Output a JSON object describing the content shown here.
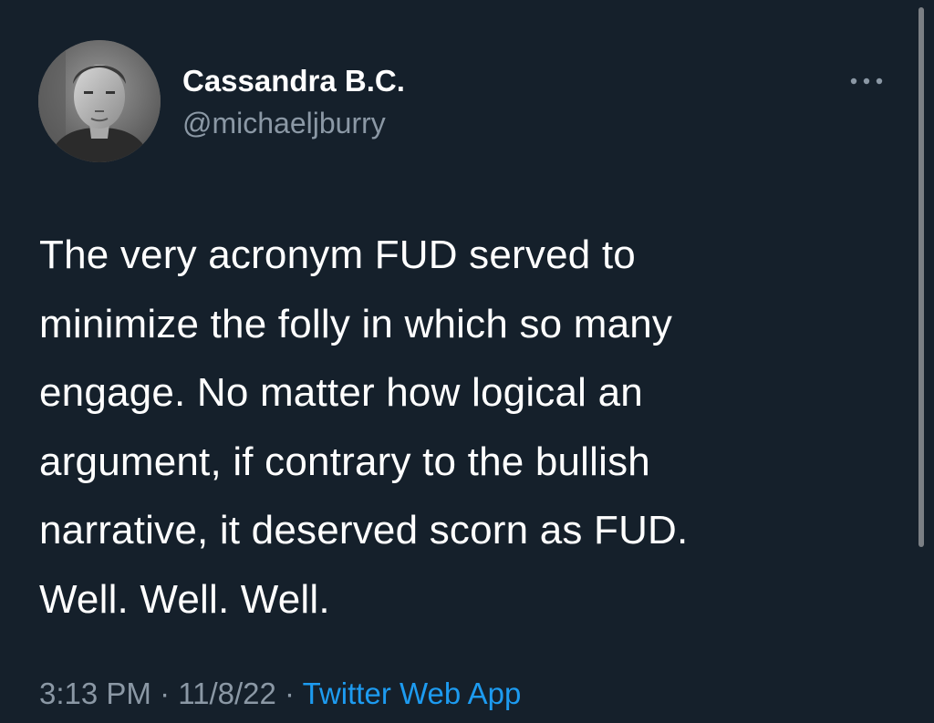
{
  "user": {
    "display_name": "Cassandra B.C.",
    "handle": "@michaeljburry",
    "avatar_icon": "user-photo-icon"
  },
  "tweet": {
    "text": "The very acronym FUD served to\nminimize the folly in which so many\nengage. No matter how logical an\nargument, if contrary to the bullish\nnarrative, it deserved scorn as FUD.\nWell. Well. Well.",
    "time": "3:13 PM",
    "separator": " · ",
    "date": "11/8/22",
    "source": "Twitter Web App"
  },
  "actions": {
    "more_icon": "more-horizontal-icon"
  },
  "colors": {
    "background": "#15202b",
    "primary_text": "#ffffff",
    "secondary_text": "#8b98a5",
    "link": "#1d9bf0"
  }
}
